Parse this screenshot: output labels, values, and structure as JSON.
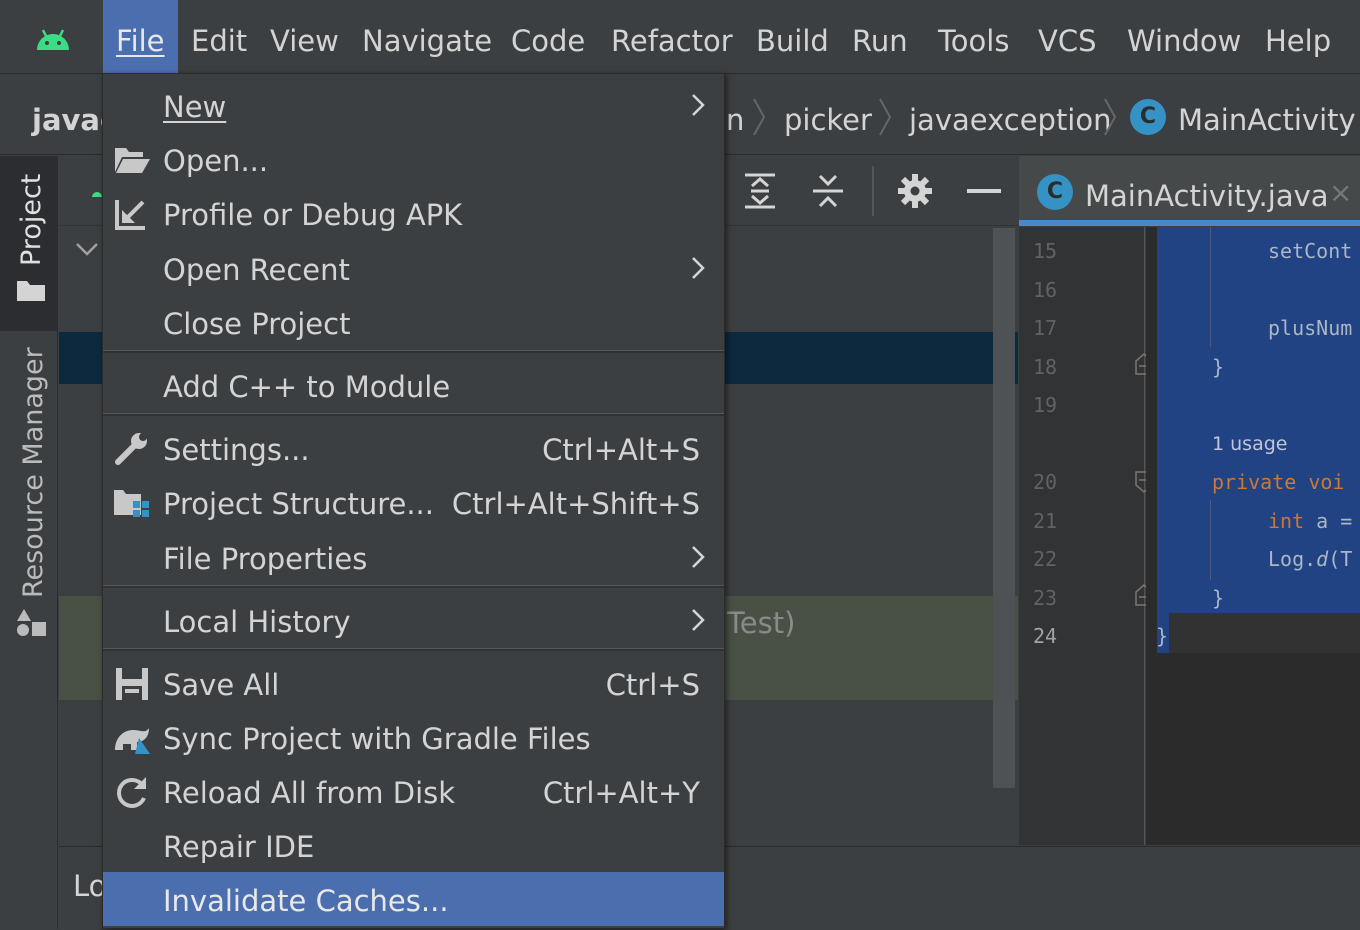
{
  "menubar": {
    "items": [
      {
        "label": "File"
      },
      {
        "label": "Edit"
      },
      {
        "label": "View"
      },
      {
        "label": "Navigate"
      },
      {
        "label": "Code"
      },
      {
        "label": "Refactor"
      },
      {
        "label": "Build"
      },
      {
        "label": "Run"
      },
      {
        "label": "Tools"
      },
      {
        "label": "VCS"
      },
      {
        "label": "Window"
      },
      {
        "label": "Help"
      }
    ]
  },
  "breadcrumb": {
    "project": "javae",
    "partial": "n",
    "items": [
      "picker",
      "javaexception"
    ],
    "class_icon": "C",
    "class_name": "MainActivity"
  },
  "left_tabs": {
    "project": "Project",
    "resource_manager": "Resource Manager"
  },
  "project_panel": {
    "green_row_text": "Test)",
    "bottom_text": "Lo"
  },
  "editor": {
    "tab": {
      "icon": "C",
      "title": "MainActivity.java",
      "close": "×"
    },
    "line_numbers": [
      "15",
      "16",
      "17",
      "18",
      "19",
      "20",
      "21",
      "22",
      "23",
      "24"
    ],
    "code": {
      "l15": "setCont",
      "l17": "plusNum",
      "l18": "}",
      "usage_hint": "1 usage",
      "l20": "private voi",
      "l21_kw": "int",
      "l21_rest": " a =",
      "l22_a": "Log.",
      "l22_b": "d",
      "l22_c": "(T",
      "l23": "}",
      "l24": "}"
    }
  },
  "file_menu": {
    "items": [
      {
        "label": "New",
        "submenu": true
      },
      {
        "label": "Open...",
        "icon": "folder-open-icon"
      },
      {
        "label": "Profile or Debug APK",
        "icon": "profile-apk-icon"
      },
      {
        "label": "Open Recent",
        "submenu": true
      },
      {
        "label": "Close Project"
      },
      {
        "label": "Add C++ to Module"
      },
      {
        "label": "Settings...",
        "shortcut": "Ctrl+Alt+S",
        "icon": "wrench-icon"
      },
      {
        "label": "Project Structure...",
        "shortcut": "Ctrl+Alt+Shift+S",
        "icon": "project-structure-icon"
      },
      {
        "label": "File Properties",
        "submenu": true
      },
      {
        "label": "Local History",
        "submenu": true
      },
      {
        "label": "Save All",
        "shortcut": "Ctrl+S",
        "icon": "save-icon"
      },
      {
        "label": "Sync Project with Gradle Files",
        "icon": "gradle-sync-icon"
      },
      {
        "label": "Reload All from Disk",
        "shortcut": "Ctrl+Alt+Y",
        "icon": "reload-icon"
      },
      {
        "label": "Repair IDE"
      },
      {
        "label": "Invalidate Caches...",
        "highlighted": true
      }
    ]
  },
  "colors": {
    "accent": "#4b6eaf",
    "selection": "#214283",
    "keyword": "#cc7832",
    "android": "#3ddc84"
  }
}
